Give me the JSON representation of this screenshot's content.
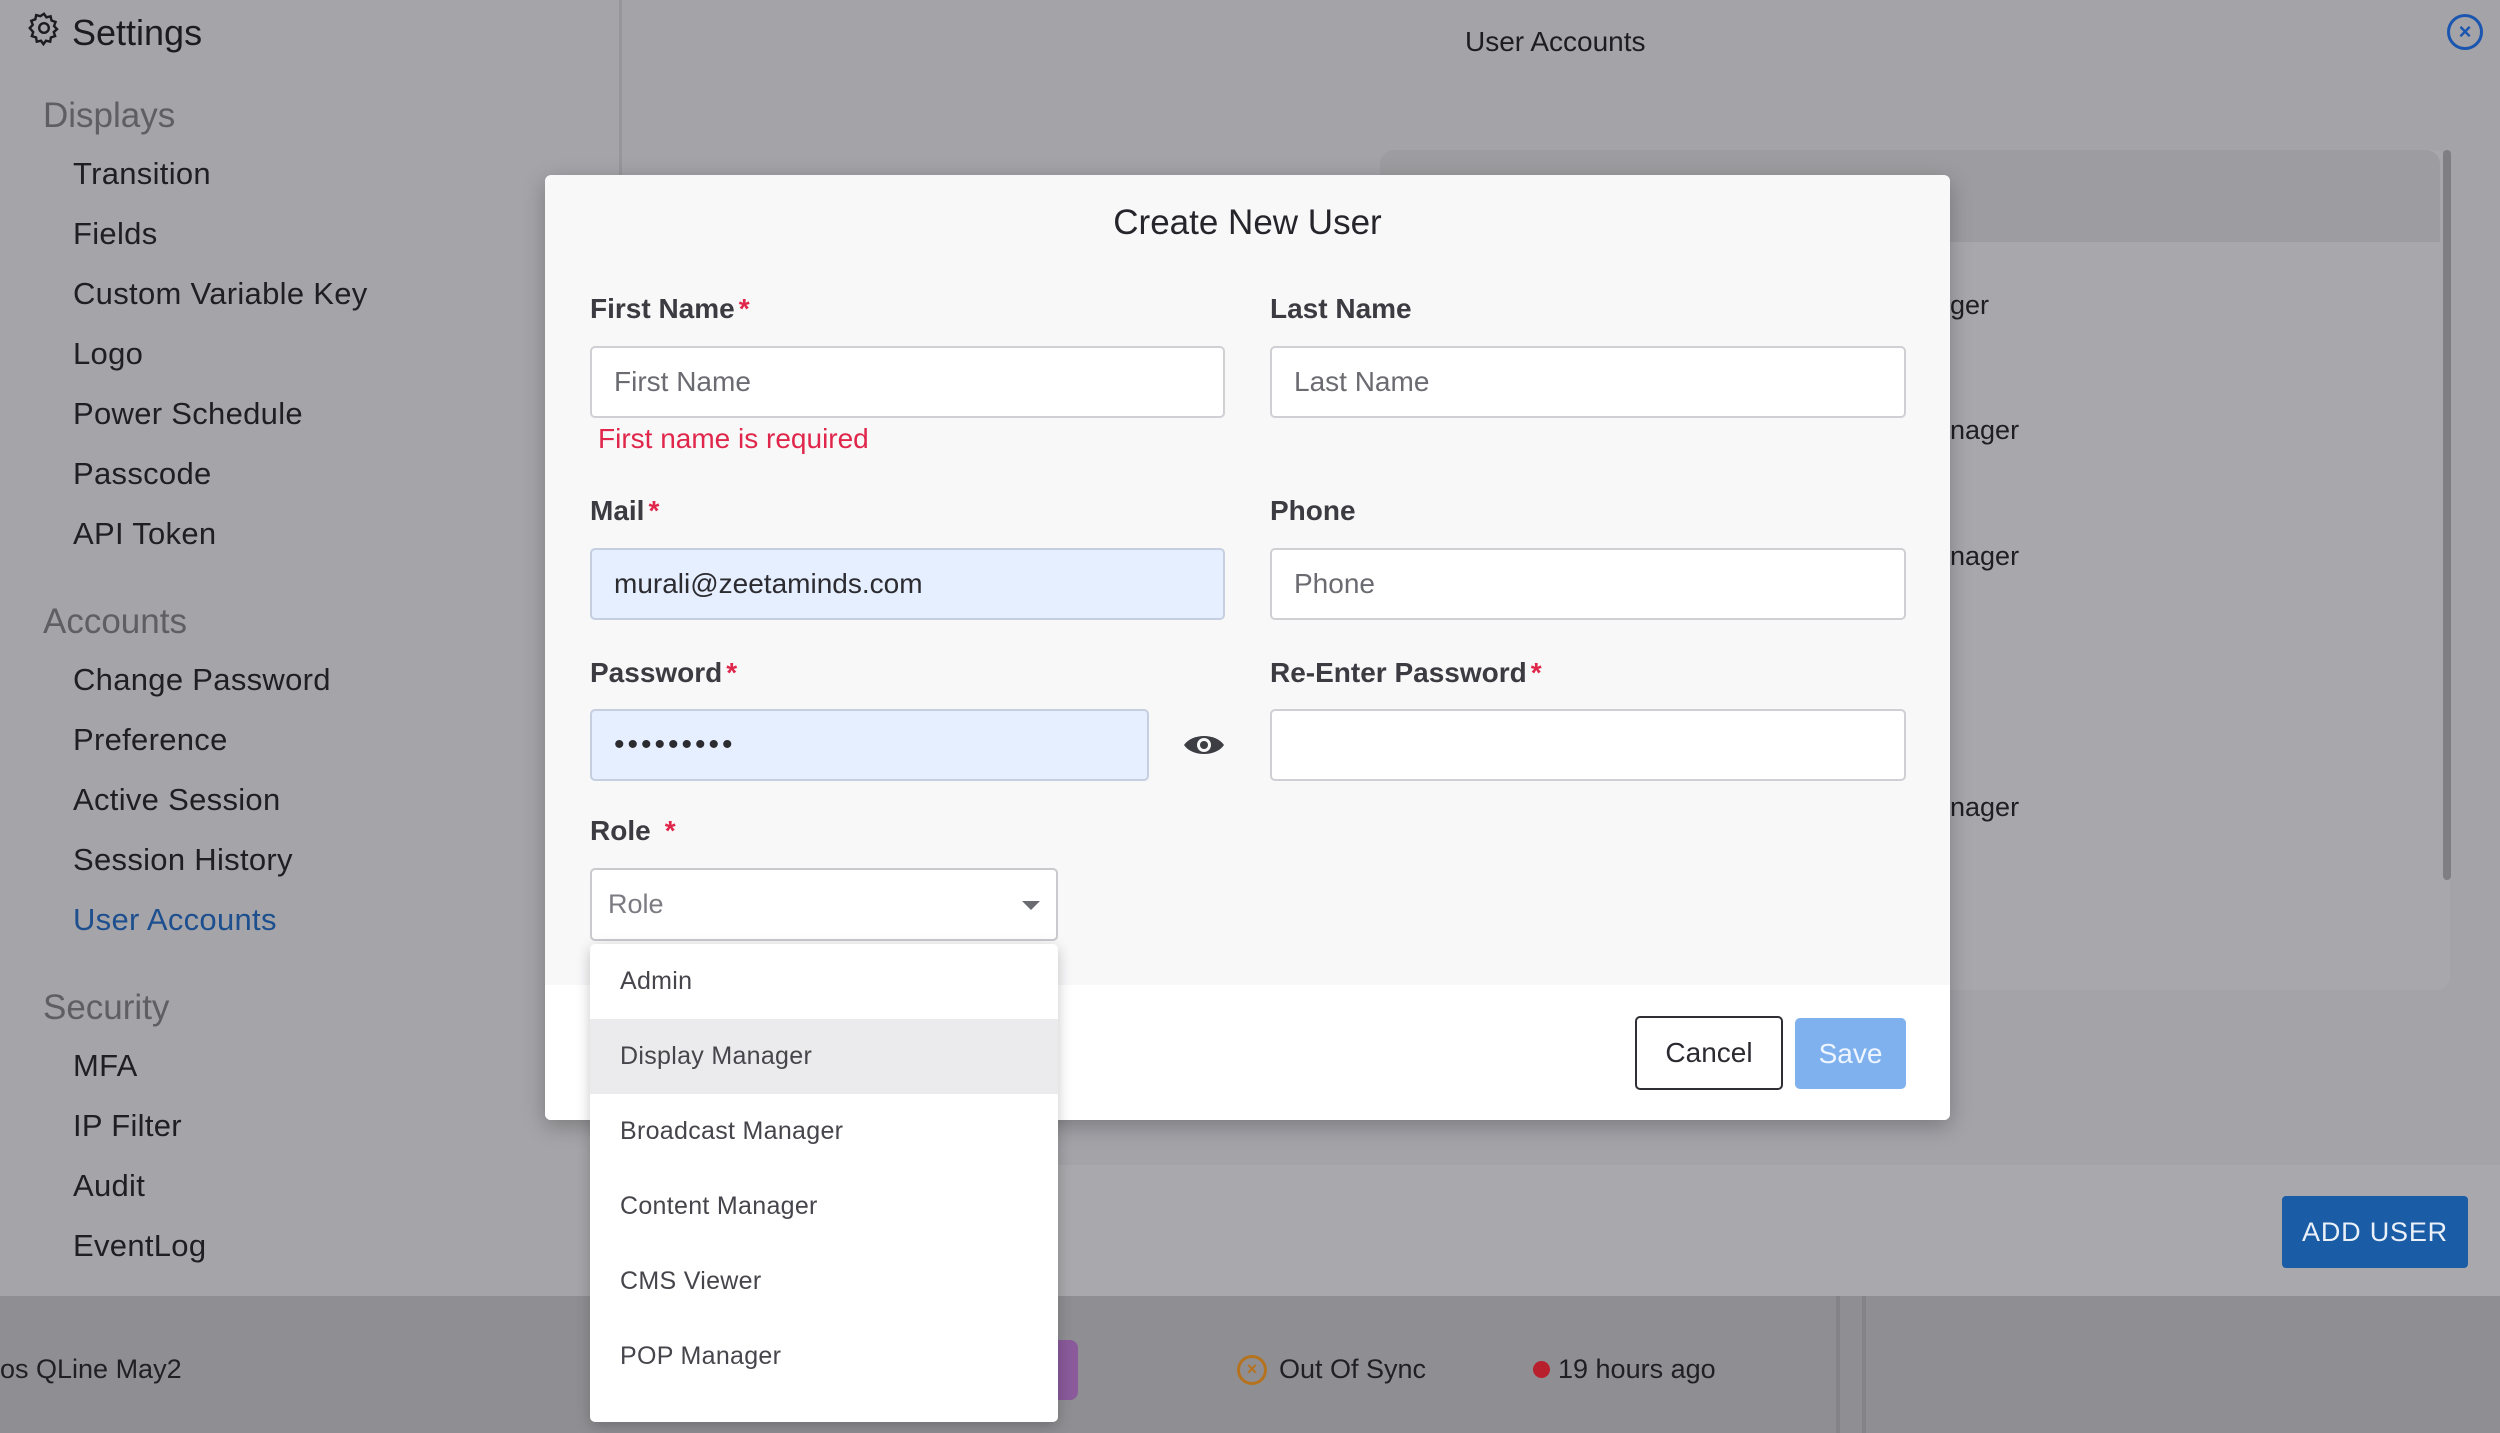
{
  "settings": {
    "title": "Settings",
    "sections": [
      {
        "label": "Displays",
        "items": [
          "Transition",
          "Fields",
          "Custom Variable Key",
          "Logo",
          "Power Schedule",
          "Passcode",
          "API Token"
        ]
      },
      {
        "label": "Accounts",
        "items": [
          "Change Password",
          "Preference",
          "Active Session",
          "Session History",
          "User Accounts"
        ]
      },
      {
        "label": "Security",
        "items": [
          "MFA",
          "IP Filter",
          "Audit",
          "EventLog"
        ]
      }
    ],
    "active_item": "User Accounts"
  },
  "main": {
    "title": "User Accounts",
    "background_roles": [
      "ger",
      "nager",
      "nager",
      "nager"
    ],
    "add_user_label": "ADD USER"
  },
  "background_row": {
    "name": "os QLine May2",
    "status": "Out Of Sync",
    "last_seen": "19 hours ago"
  },
  "modal": {
    "title": "Create New User",
    "first_name": {
      "label": "First Name",
      "required_mark": "*",
      "placeholder": "First Name",
      "error": "First name is required"
    },
    "last_name": {
      "label": "Last Name",
      "placeholder": "Last Name"
    },
    "mail": {
      "label": "Mail",
      "required_mark": "*",
      "value": "murali@zeetaminds.com"
    },
    "phone": {
      "label": "Phone",
      "placeholder": "Phone"
    },
    "password": {
      "label": "Password",
      "required_mark": "*",
      "value": "•••••••••"
    },
    "reenter_password": {
      "label": "Re-Enter Password",
      "required_mark": "*",
      "value": ""
    },
    "role": {
      "label": "Role",
      "required_mark": "*",
      "placeholder": "Role",
      "options": [
        "Admin",
        "Display Manager",
        "Broadcast Manager",
        "Content Manager",
        "CMS Viewer",
        "POP Manager"
      ],
      "highlighted": "Display Manager"
    },
    "cancel_label": "Cancel",
    "save_label": "Save"
  },
  "colors": {
    "accent": "#1a5ca6",
    "error": "#e0264a",
    "save_disabled": "#7fb1ee",
    "autofill_bg": "#e6efff"
  }
}
